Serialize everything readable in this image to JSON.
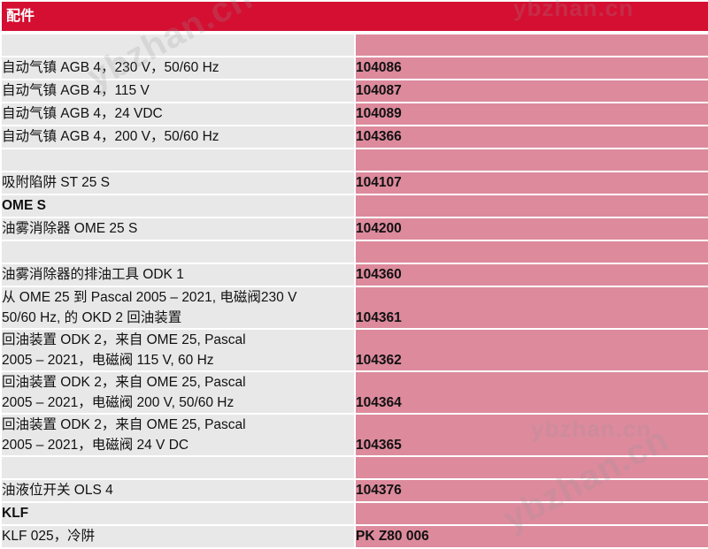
{
  "header": {
    "title": "配件"
  },
  "watermark_text": "ybzhan.cn",
  "rows": [
    {
      "type": "blank"
    },
    {
      "type": "single",
      "lines": [
        "自动气镇 AGB 4，230 V，50/60 Hz"
      ],
      "number": "104086"
    },
    {
      "type": "single",
      "lines": [
        "自动气镇 AGB 4，115 V"
      ],
      "number": "104087"
    },
    {
      "type": "single",
      "lines": [
        "自动气镇 AGB 4，24 VDC"
      ],
      "number": "104089"
    },
    {
      "type": "single",
      "lines": [
        "自动气镇 AGB 4，200 V，50/60 Hz"
      ],
      "number": "104366"
    },
    {
      "type": "blank"
    },
    {
      "type": "single",
      "lines": [
        "吸附陷阱 ST 25 S"
      ],
      "number": "104107"
    },
    {
      "type": "heading",
      "lines": [
        "OME S"
      ],
      "number": ""
    },
    {
      "type": "single",
      "lines": [
        "油雾消除器 OME 25 S"
      ],
      "number": "104200"
    },
    {
      "type": "blank"
    },
    {
      "type": "single",
      "lines": [
        "油雾消除器的排油工具 ODK 1"
      ],
      "number": "104360"
    },
    {
      "type": "double",
      "lines": [
        "从 OME 25 到 Pascal 2005 – 2021, 电磁阀230 V",
        "50/60 Hz, 的 OKD 2 回油装置"
      ],
      "number": "104361"
    },
    {
      "type": "double",
      "lines": [
        "回油装置 ODK 2，来自 OME 25, Pascal",
        "2005 – 2021，电磁阀 115 V, 60 Hz"
      ],
      "number": "104362"
    },
    {
      "type": "double",
      "lines": [
        "回油装置 ODK 2，来自 OME 25, Pascal",
        "2005 – 2021，电磁阀 200 V, 50/60 Hz"
      ],
      "number": "104364"
    },
    {
      "type": "double",
      "lines": [
        "回油装置 ODK 2，来自 OME 25, Pascal",
        "2005 – 2021，电磁阀 24 V DC"
      ],
      "number": "104365"
    },
    {
      "type": "blank"
    },
    {
      "type": "single",
      "lines": [
        "油液位开关 OLS 4"
      ],
      "number": "104376"
    },
    {
      "type": "heading",
      "lines": [
        "KLF"
      ],
      "number": ""
    },
    {
      "type": "single",
      "lines": [
        "KLF 025，冷阱"
      ],
      "number": "PK Z80 006"
    }
  ]
}
